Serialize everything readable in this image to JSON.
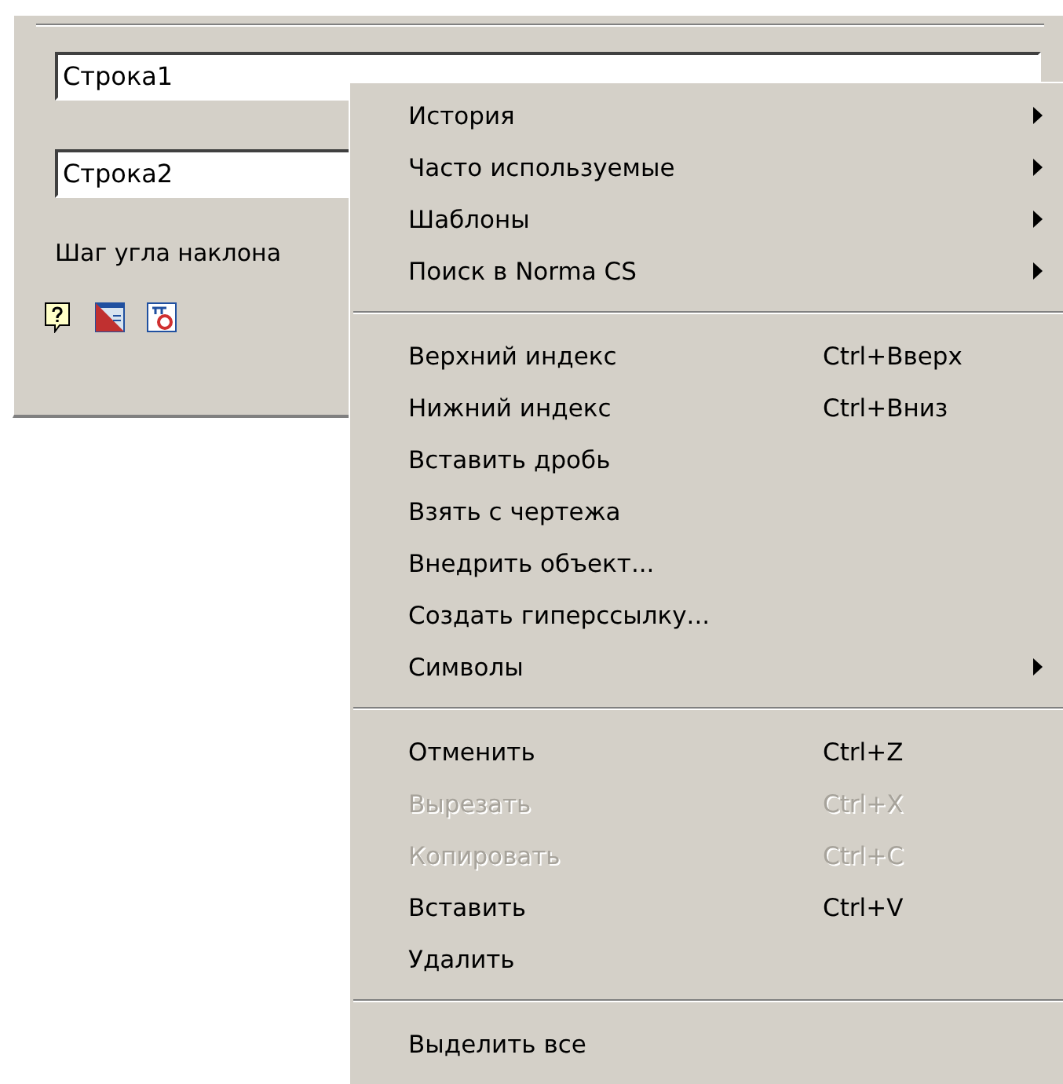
{
  "dialog": {
    "fields": [
      {
        "value": "Строка1"
      },
      {
        "value": "Строка2"
      }
    ],
    "angle_label": "Шаг угла наклона"
  },
  "context_menu": {
    "groups": [
      [
        {
          "label": "История",
          "submenu": true,
          "disabled": false
        },
        {
          "label": "Часто используемые",
          "submenu": true,
          "disabled": false
        },
        {
          "label": "Шаблоны",
          "submenu": true,
          "disabled": false
        },
        {
          "label": "Поиск в Norma CS",
          "submenu": true,
          "disabled": false
        }
      ],
      [
        {
          "label": "Верхний индекс",
          "shortcut": "Ctrl+Вверх",
          "submenu": false,
          "disabled": false
        },
        {
          "label": "Нижний индекс",
          "shortcut": "Ctrl+Вниз",
          "submenu": false,
          "disabled": false
        },
        {
          "label": "Вставить дробь",
          "submenu": false,
          "disabled": false
        },
        {
          "label": "Взять с чертежа",
          "submenu": false,
          "disabled": false
        },
        {
          "label": "Внедрить объект...",
          "submenu": false,
          "disabled": false
        },
        {
          "label": "Создать гиперссылку...",
          "submenu": false,
          "disabled": false
        },
        {
          "label": "Символы",
          "submenu": true,
          "disabled": false
        }
      ],
      [
        {
          "label": "Отменить",
          "shortcut": "Ctrl+Z",
          "submenu": false,
          "disabled": false
        },
        {
          "label": "Вырезать",
          "shortcut": "Ctrl+X",
          "submenu": false,
          "disabled": true
        },
        {
          "label": "Копировать",
          "shortcut": "Ctrl+C",
          "submenu": false,
          "disabled": true
        },
        {
          "label": "Вставить",
          "shortcut": "Ctrl+V",
          "submenu": false,
          "disabled": false
        },
        {
          "label": "Удалить",
          "submenu": false,
          "disabled": false
        }
      ],
      [
        {
          "label": "Выделить все",
          "submenu": false,
          "disabled": false
        }
      ]
    ]
  }
}
